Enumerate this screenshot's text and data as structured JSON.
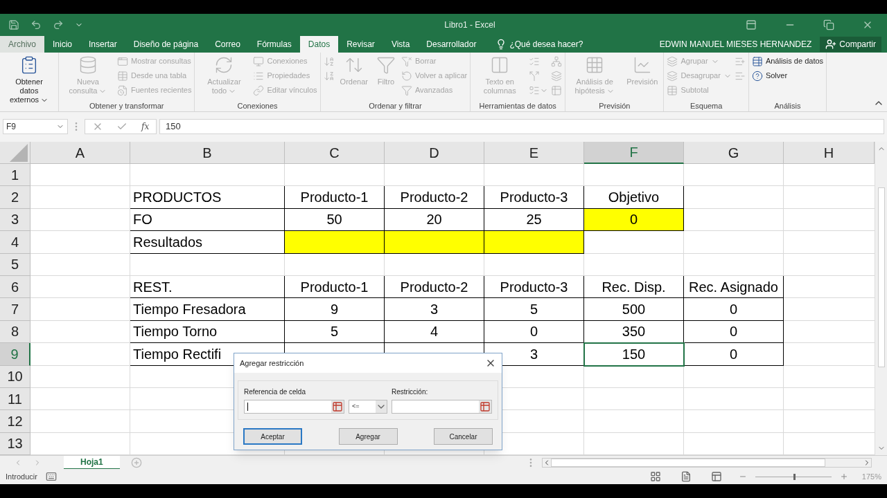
{
  "window": {
    "title": "Libro1 - Excel"
  },
  "tabs": [
    {
      "label": "Archivo",
      "selected": false
    },
    {
      "label": "Inicio",
      "selected": false
    },
    {
      "label": "Insertar",
      "selected": false
    },
    {
      "label": "Diseño de página",
      "selected": false
    },
    {
      "label": "Correo",
      "selected": false
    },
    {
      "label": "Fórmulas",
      "selected": false
    },
    {
      "label": "Datos",
      "selected": true
    },
    {
      "label": "Revisar",
      "selected": false
    },
    {
      "label": "Vista",
      "selected": false
    },
    {
      "label": "Desarrollador",
      "selected": false
    }
  ],
  "tell_me": {
    "placeholder": "¿Qué desea hacer?"
  },
  "user": "EDWIN MANUEL MIESES HERNANDEZ",
  "share_button": "Compartir",
  "ribbon_groups": [
    {
      "items": [
        {
          "kind": "large",
          "label": "Obtener datos externos",
          "menu": true,
          "disabled": false
        }
      ]
    },
    {
      "label": "Obtener y transformar",
      "items": [
        {
          "kind": "large",
          "label": "Nueva consulta",
          "menu": true,
          "disabled": true
        },
        {
          "kind": "small",
          "label": "Mostrar consultas",
          "menu": false,
          "disabled": true
        },
        {
          "kind": "small",
          "label": "Desde una tabla",
          "menu": false,
          "disabled": true
        },
        {
          "kind": "small",
          "label": "Fuentes recientes",
          "menu": false,
          "disabled": true
        }
      ]
    },
    {
      "label": "Conexiones",
      "items": [
        {
          "kind": "large",
          "label": "Actualizar todo",
          "menu": true,
          "disabled": true
        },
        {
          "kind": "small",
          "label": "Conexiones",
          "menu": false,
          "disabled": true
        },
        {
          "kind": "small",
          "label": "Propiedades",
          "menu": false,
          "disabled": true
        },
        {
          "kind": "small",
          "label": "Editar vínculos",
          "menu": false,
          "disabled": true
        }
      ]
    },
    {
      "label": "Ordenar y filtrar",
      "items": [
        {
          "kind": "icon",
          "menu": false,
          "disabled": true
        },
        {
          "kind": "icon",
          "menu": false,
          "disabled": true
        },
        {
          "kind": "large",
          "label": "Ordenar",
          "menu": false,
          "disabled": true
        },
        {
          "kind": "large",
          "label": "Filtro",
          "menu": false,
          "disabled": true
        },
        {
          "kind": "small",
          "label": "Borrar",
          "menu": false,
          "disabled": true
        },
        {
          "kind": "small",
          "label": "Volver a aplicar",
          "menu": false,
          "disabled": true
        },
        {
          "kind": "small",
          "label": "Avanzadas",
          "menu": false,
          "disabled": true
        }
      ]
    },
    {
      "label": "Herramientas de datos",
      "items": [
        {
          "kind": "large",
          "label": "Texto en columnas",
          "menu": false,
          "disabled": true
        },
        {
          "kind": "icon",
          "menu": false,
          "disabled": true
        },
        {
          "kind": "icon",
          "menu": false,
          "disabled": true
        },
        {
          "kind": "icon",
          "menu": true,
          "disabled": true
        },
        {
          "kind": "icon",
          "menu": false,
          "disabled": true
        },
        {
          "kind": "icon",
          "menu": false,
          "disabled": true
        },
        {
          "kind": "icon",
          "menu": false,
          "disabled": true
        }
      ]
    },
    {
      "label": "Previsión",
      "items": [
        {
          "kind": "large",
          "label": "Análisis de hipótesis",
          "menu": true,
          "disabled": true
        },
        {
          "kind": "large",
          "label": "Previsión",
          "menu": false,
          "disabled": true
        }
      ]
    },
    {
      "label": "Esquema",
      "items": [
        {
          "kind": "small",
          "label": "Agrupar",
          "menu": true,
          "disabled": true
        },
        {
          "kind": "small",
          "label": "Desagrupar",
          "menu": true,
          "disabled": true
        },
        {
          "kind": "small",
          "label": "Subtotal",
          "menu": false,
          "disabled": true
        },
        {
          "kind": "icon",
          "menu": false,
          "disabled": true
        },
        {
          "kind": "icon",
          "menu": false,
          "disabled": true
        }
      ]
    },
    {
      "label": "Análisis",
      "items": [
        {
          "kind": "small",
          "label": "Análisis de datos",
          "menu": false,
          "disabled": false
        },
        {
          "kind": "small",
          "label": "Solver",
          "menu": false,
          "disabled": false
        }
      ]
    }
  ],
  "formula_bar": {
    "name_box": "F9",
    "function_label": "fx",
    "value": "150"
  },
  "columns": [
    {
      "label": "A",
      "selected": false
    },
    {
      "label": "B",
      "selected": false
    },
    {
      "label": "C",
      "selected": false
    },
    {
      "label": "D",
      "selected": false
    },
    {
      "label": "E",
      "selected": false
    },
    {
      "label": "F",
      "selected": true
    },
    {
      "label": "G",
      "selected": false
    },
    {
      "label": "H",
      "selected": false
    }
  ],
  "rows": [
    {
      "number": "1",
      "selected": false,
      "cells": [
        {},
        {},
        {},
        {},
        {},
        {},
        {},
        {}
      ]
    },
    {
      "number": "2",
      "selected": false,
      "cells": [
        {},
        {
          "text": "PRODUCTOS",
          "bordered": true
        },
        {
          "text": "Producto-1",
          "bordered": true
        },
        {
          "text": "Producto-2",
          "bordered": true
        },
        {
          "text": "Producto-3",
          "bordered": true
        },
        {
          "text": "Objetivo",
          "bordered": true
        },
        {},
        {}
      ]
    },
    {
      "number": "3",
      "selected": false,
      "cells": [
        {},
        {
          "text": "FO",
          "bordered": true
        },
        {
          "text": "50",
          "bordered": true
        },
        {
          "text": "20",
          "bordered": true
        },
        {
          "text": "25",
          "bordered": true
        },
        {
          "text": "0",
          "bordered": true,
          "color": "#ffff00"
        },
        {},
        {}
      ]
    },
    {
      "number": "4",
      "selected": false,
      "cells": [
        {},
        {
          "text": "Resultados",
          "bordered": true
        },
        {
          "bordered": true,
          "color": "#ffff00"
        },
        {
          "bordered": true,
          "color": "#ffff00"
        },
        {
          "bordered": true,
          "color": "#ffff00"
        },
        {},
        {},
        {}
      ]
    },
    {
      "number": "5",
      "selected": false,
      "cells": [
        {},
        {},
        {},
        {},
        {},
        {},
        {},
        {}
      ]
    },
    {
      "number": "6",
      "selected": false,
      "cells": [
        {},
        {
          "text": "REST.",
          "bordered": true
        },
        {
          "text": "Producto-1",
          "bordered": true
        },
        {
          "text": "Producto-2",
          "bordered": true
        },
        {
          "text": "Producto-3",
          "bordered": true
        },
        {
          "text": "Rec. Disp.",
          "bordered": true
        },
        {
          "text": "Rec. Asignado",
          "bordered": true
        },
        {}
      ]
    },
    {
      "number": "7",
      "selected": false,
      "cells": [
        {},
        {
          "text": "Tiempo Fresadora",
          "bordered": true
        },
        {
          "text": "9",
          "bordered": true
        },
        {
          "text": "3",
          "bordered": true
        },
        {
          "text": "5",
          "bordered": true
        },
        {
          "text": "500",
          "bordered": true
        },
        {
          "text": "0",
          "bordered": true
        },
        {}
      ]
    },
    {
      "number": "8",
      "selected": false,
      "cells": [
        {},
        {
          "text": "Tiempo Torno",
          "bordered": true
        },
        {
          "text": "5",
          "bordered": true
        },
        {
          "text": "4",
          "bordered": true
        },
        {
          "text": "0",
          "bordered": true
        },
        {
          "text": "350",
          "bordered": true
        },
        {
          "text": "0",
          "bordered": true
        },
        {}
      ]
    },
    {
      "number": "9",
      "selected": true,
      "cells": [
        {},
        {
          "text": "Tiempo Rectifi",
          "bordered": true
        },
        {
          "bordered": true
        },
        {
          "bordered": true
        },
        {
          "text": "3",
          "bordered": true
        },
        {
          "text": "150",
          "bordered": true,
          "selected": true
        },
        {
          "text": "0",
          "bordered": true
        },
        {}
      ]
    },
    {
      "number": "10",
      "selected": false,
      "cells": [
        {},
        {},
        {},
        {},
        {},
        {},
        {},
        {}
      ]
    },
    {
      "number": "11",
      "selected": false,
      "cells": [
        {},
        {},
        {},
        {},
        {},
        {},
        {},
        {}
      ]
    },
    {
      "number": "12",
      "selected": false,
      "cells": [
        {},
        {},
        {},
        {},
        {},
        {},
        {},
        {}
      ]
    },
    {
      "number": "13",
      "selected": false,
      "cells": [
        {},
        {},
        {},
        {},
        {},
        {},
        {},
        {}
      ]
    }
  ],
  "sheet_tabs": [
    {
      "label": "Hoja1",
      "selected": true
    }
  ],
  "status_bar": {
    "mode": "Introducir",
    "zoom": "175%",
    "zoom_slider": {
      "level": 0.5
    }
  },
  "dialog": {
    "title": "Agregar restricción",
    "cell_reference": {
      "label": "Referencia de celda"
    },
    "operator": "<=",
    "constraint": {
      "label": "Restricción:"
    },
    "buttons": [
      {
        "label": "Aceptar",
        "focused": true
      },
      {
        "label": "Agregar",
        "focused": false
      },
      {
        "label": "Cancelar",
        "focused": false
      }
    ]
  }
}
